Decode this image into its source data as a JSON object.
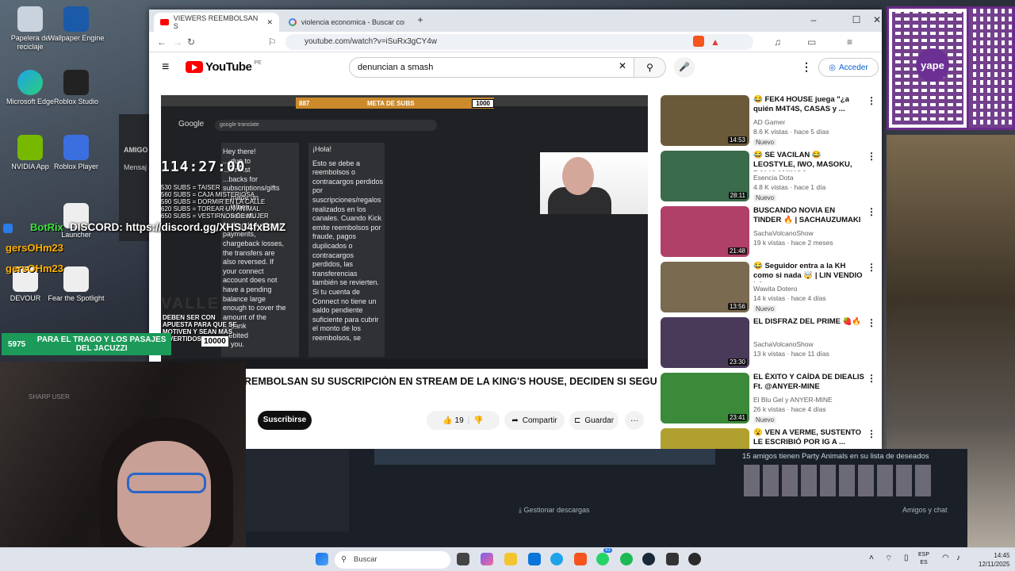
{
  "desktop": {
    "icons": [
      "Papelera de reciclaje",
      "Wallpaper Engine",
      "Microsoft Edge",
      "Roblox Studio",
      "NVIDIA App",
      "Roblox Player",
      "Launcher",
      "DEVOUR",
      "Fear the Spotlight"
    ]
  },
  "stream_overlay": {
    "timer": "114:27:00",
    "subs_goal_left": "887",
    "subs_goal_title": "META DE SUBS",
    "subs_goal_right": "1000",
    "sub_rewards": [
      "530 SUBS = TAISER",
      "560 SUBS = CAJA MISTERIOSA",
      "590 SUBS = DORMIR EN LA CALLE",
      "620 SUBS = TOREAR UN ANIMAL",
      "650 SUBS = VESTIRNOS DE MUJER"
    ],
    "discord_user": "BotRix",
    "discord_text": "DISCORD: https://discord.gg/XHSJ4fxBMZ",
    "chat_user_1": "gersOHm23",
    "chat_user_2": "gersOHm23",
    "bottom_counter": "5975",
    "bottom_goal": "PARA EL TRAGO Y LOS PASAJES DEL JACUZZI",
    "bottom_counter_right": "10000",
    "valle_text": "VALLE",
    "sharp_user": "SHARP USER",
    "promo_text": "DEBEN SER CON APUESTA PARA QUE SE MOTIVEN Y SEAN MAS DIVERTIDOS",
    "side_label": "AMIGO",
    "side_msg": "Mensaj"
  },
  "browser": {
    "tabs": [
      {
        "label": "VIEWERS REEMBOLSAN S",
        "active": true
      },
      {
        "label": "violencia economica - Buscar con Go",
        "active": false
      }
    ],
    "url": "youtube.com/watch?v=iSuRx3gCY4w"
  },
  "youtube": {
    "logo_text": "YouTube",
    "region": "PE",
    "search_query": "denuncian a smash",
    "signin_label": "Acceder",
    "video_title": "REMBOLSAN SU SUSCRIPCIÓN EN STREAM DE LA KING'S HOUSE, DECIDEN SI SEGUIR",
    "subscribe_label": "Suscribirse",
    "likes": "19",
    "share_label": "Compartir",
    "save_label": "Guardar",
    "recommendations": [
      {
        "title": "😂 FEK4 HOUSE juega \"¿a quién M4T4S, CASAS y ...",
        "channel": "AD Gamer",
        "meta": "8.6 K vistas · hace 5 días",
        "badge": "Nuevo",
        "duration": "14:53",
        "color": "#6b5a3a"
      },
      {
        "title": "😂 SE VACILAN 😂 LEOSTYLE, IWO, MASOKU, BALIGAMINGS...",
        "channel": "Esencia Dota",
        "meta": "4.8 K vistas · hace 1 día",
        "badge": "Nuevo",
        "duration": "28:11",
        "color": "#3a6b4a"
      },
      {
        "title": "BUSCANDO NOVIA EN TINDER 🔥 | SACHAUZUMAKI",
        "channel": "SachaVolcanoShow",
        "meta": "19 k vistas · hace 2 meses",
        "badge": "",
        "duration": "21:48",
        "color": "#b04068"
      },
      {
        "title": "😂 Seguidor entra a la KH como si nada 🤯 | LIN VENDIO LA ...",
        "channel": "Wawita Dotero",
        "meta": "14 k vistas · hace 4 días",
        "badge": "Nuevo",
        "duration": "13:56",
        "color": "#7a6a50"
      },
      {
        "title": "EL DISFRAZ DEL PRIME 🍓🔥",
        "channel": "SachaVolcanoShow",
        "meta": "13 k vistas · hace 11 días",
        "badge": "",
        "duration": "23:30",
        "color": "#4a3a5a"
      },
      {
        "title": "EL ÉXITO Y CAÍDA DE DIEALIS Ft. @ANYER-MINE",
        "channel": "El Blu Gel y ANYER-MINE",
        "meta": "26 k vistas · hace 4 días",
        "badge": "Nuevo",
        "duration": "23:41",
        "color": "#3a8a3a"
      },
      {
        "title": "😮 VEN A VERME, SUSTENTO LE ESCRIBIÓ POR IG A ...",
        "channel": "",
        "meta": "",
        "badge": "",
        "duration": "",
        "color": "#b0a030"
      }
    ]
  },
  "inner_video": {
    "google_query": "google translate",
    "left_panel": "Hey there!\n... due to\n... or lost\n...backs for\nsubscriptions/gifts\n... made on\n... When\n... refunds\nfor fraud, duplicate\npayments,\nchargeback losses,\nthe transfers are\nalso reversed. If\nyour connect\naccount does not\nhave a pending\nbalance large\nenough to cover the\namount of the\n... bank\n...ebited\n... you.",
    "right_panel_title": "¡Hola!",
    "right_panel": "Esto se debe a reembolsos o contracargos perdidos por suscripciones/regalos realizados en los canales. Cuando Kick emite reembolsos por fraude, pagos duplicados o contracargos perdidos, las transferencias también se revierten. Si tu cuenta de Connect no tiene un saldo pendiente suficiente para cubrir el monto de los reembolsos, se"
  },
  "steam": {
    "friends_wishlist": "15 amigos tienen Party Animals en su lista de deseados",
    "downloads": "Gestionar descargas",
    "friends_chat": "Amigos y chat"
  },
  "taskbar": {
    "search_placeholder": "Buscar",
    "lang": "ESP",
    "lang2": "ES",
    "time": "14:45",
    "date": "12/11/2025",
    "badge": "93"
  },
  "qr": {
    "brand": "yape"
  }
}
